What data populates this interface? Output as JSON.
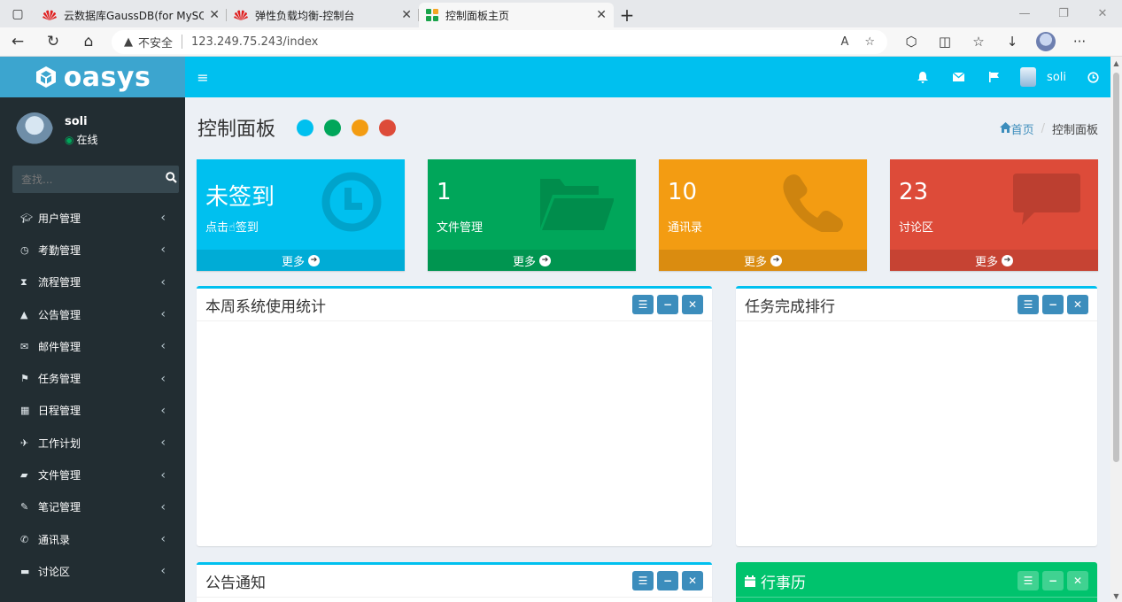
{
  "browser": {
    "tabs": [
      {
        "title": "云数据库GaussDB(for MySQL)-控"
      },
      {
        "title": "弹性负载均衡-控制台"
      },
      {
        "title": "控制面板主页"
      }
    ],
    "address": {
      "security_label": "不安全",
      "url": "123.249.75.243/index"
    }
  },
  "app": {
    "logo": "oasys",
    "top_user": "soli"
  },
  "sidebar": {
    "user_name": "soli",
    "status": "在线",
    "search_placeholder": "查找...",
    "items": [
      {
        "label": "用户管理",
        "icon": "graduation-cap-icon"
      },
      {
        "label": "考勤管理",
        "icon": "clock-icon"
      },
      {
        "label": "流程管理",
        "icon": "hourglass-icon"
      },
      {
        "label": "公告管理",
        "icon": "bell-icon"
      },
      {
        "label": "邮件管理",
        "icon": "envelope-icon"
      },
      {
        "label": "任务管理",
        "icon": "flag-icon"
      },
      {
        "label": "日程管理",
        "icon": "calendar-icon"
      },
      {
        "label": "工作计划",
        "icon": "plane-icon"
      },
      {
        "label": "文件管理",
        "icon": "folder-open-icon"
      },
      {
        "label": "笔记管理",
        "icon": "edit-icon"
      },
      {
        "label": "通讯录",
        "icon": "phone-icon"
      },
      {
        "label": "讨论区",
        "icon": "comment-icon"
      }
    ]
  },
  "page": {
    "title": "控制面板",
    "dot_colors": [
      "#00c0ef",
      "#00a65a",
      "#f39c12",
      "#dd4b39"
    ],
    "breadcrumb": {
      "home": "首页",
      "current": "控制面板"
    }
  },
  "stat_boxes": [
    {
      "value": "未签到",
      "label": "点击☝签到",
      "more": "更多",
      "color": "#00c0ef",
      "icon": "clock-icon"
    },
    {
      "value": "1",
      "label": "文件管理",
      "more": "更多",
      "color": "#00a65a",
      "icon": "folder-open-icon"
    },
    {
      "value": "10",
      "label": "通讯录",
      "more": "更多",
      "color": "#f39c12",
      "icon": "phone-icon"
    },
    {
      "value": "23",
      "label": "讨论区",
      "more": "更多",
      "color": "#dd4b39",
      "icon": "comment-icon"
    }
  ],
  "panels": {
    "weekly_stats": "本周系统使用统计",
    "task_ranking": "任务完成排行",
    "notices": "公告通知",
    "calendar": "行事历"
  }
}
